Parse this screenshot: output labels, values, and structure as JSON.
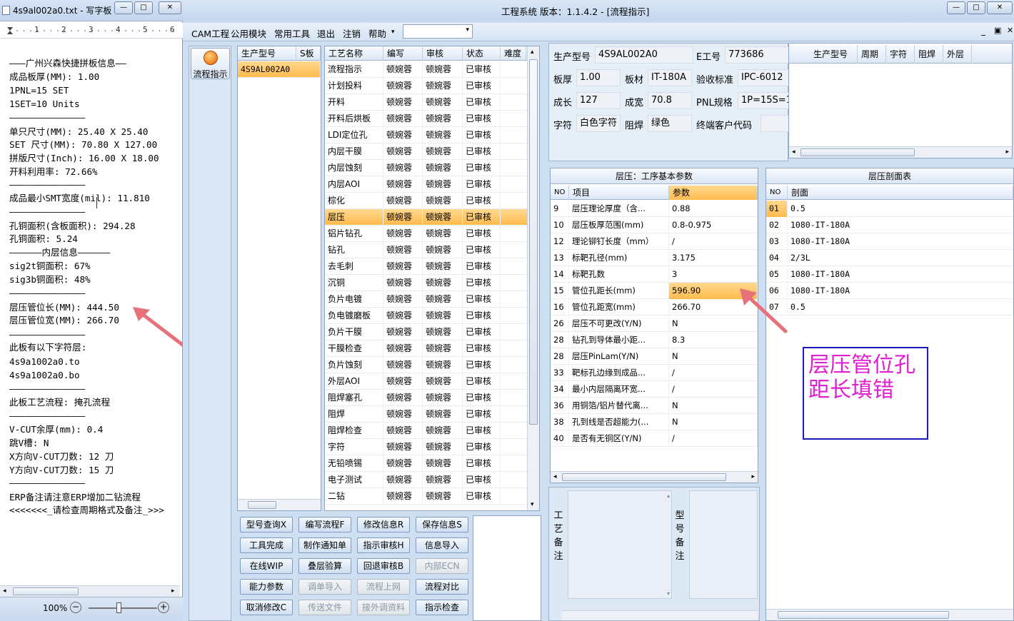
{
  "notepad": {
    "title": "4s9al002a0.txt - 写字板",
    "ruler": "·1·2·3·4·5·6",
    "ruler_marks": [
      "1",
      "2",
      "3",
      "4",
      "5",
      "6"
    ],
    "lines": [
      "———广州兴森快捷拼板信息——",
      "成品板厚(MM): 1.00",
      "1PNL=15 SET",
      "1SET=10 Units",
      "——————————————",
      "单只尺寸(MM): 25.40 X 25.40",
      "SET 尺寸(MM): 70.80 X 127.00",
      "拼版尺寸(Inch): 16.00 X 18.00",
      "开料利用率: 72.66%",
      "——————————————",
      "成品最小SMT宽度(mil): 11.810",
      "——————————————",
      "孔铜面积(含板面积): 294.28",
      "孔铜面积: 5.24",
      "——————内层信息——————",
      "sig2t铜面积: 67%",
      "sig3b铜面积: 48%",
      "——————————————",
      "层压管位长(MM): 444.50",
      "层压管位宽(MM): 266.70",
      "——————————————",
      "此板有以下字符层:",
      "4s9a1002a0.to",
      "4s9a1002a0.bo",
      "——————————————",
      "此板工艺流程: 掩孔流程",
      "——————————————",
      "V-CUT余厚(mm): 0.4",
      "跳V槽: N",
      "X方向V-CUT刀数: 12 刀",
      "Y方向V-CUT刀数: 15 刀",
      "——————————————",
      "ERP备注请注意ERP增加二钻流程",
      "<<<<<<<_请检查周期格式及备注_>>>"
    ],
    "zoom": "100%"
  },
  "app": {
    "title": "工程系统   版本：1.1.4.2 - [流程指示]",
    "menu": [
      "CAM工程",
      "公用模块",
      "常用工具",
      "退出",
      "注销",
      "帮助"
    ],
    "menu_more": "▾",
    "side_button": "流程指示",
    "model_grid": {
      "headers": [
        "生产型号",
        "S板"
      ],
      "rows": [
        [
          "4S9AL002A0",
          ""
        ]
      ]
    },
    "process_grid": {
      "headers": [
        "工艺名称",
        "编写",
        "审核",
        "状态",
        "难度"
      ],
      "rows": [
        [
          "流程指示",
          "顿婉蓉",
          "顿婉蓉",
          "已审核"
        ],
        [
          "计划投料",
          "顿婉蓉",
          "顿婉蓉",
          "已审核"
        ],
        [
          "开料",
          "顿婉蓉",
          "顿婉蓉",
          "已审核"
        ],
        [
          "开料后烘板",
          "顿婉蓉",
          "顿婉蓉",
          "已审核"
        ],
        [
          "LDI定位孔",
          "顿婉蓉",
          "顿婉蓉",
          "已审核"
        ],
        [
          "内层干膜",
          "顿婉蓉",
          "顿婉蓉",
          "已审核"
        ],
        [
          "内层蚀刻",
          "顿婉蓉",
          "顿婉蓉",
          "已审核"
        ],
        [
          "内层AOI",
          "顿婉蓉",
          "顿婉蓉",
          "已审核"
        ],
        [
          "棕化",
          "顿婉蓉",
          "顿婉蓉",
          "已审核"
        ],
        [
          "层压",
          "顿婉蓉",
          "顿婉蓉",
          "已审核"
        ],
        [
          "铝片钻孔",
          "顿婉蓉",
          "顿婉蓉",
          "已审核"
        ],
        [
          "钻孔",
          "顿婉蓉",
          "顿婉蓉",
          "已审核"
        ],
        [
          "去毛刺",
          "顿婉蓉",
          "顿婉蓉",
          "已审核"
        ],
        [
          "沉铜",
          "顿婉蓉",
          "顿婉蓉",
          "已审核"
        ],
        [
          "负片电镀",
          "顿婉蓉",
          "顿婉蓉",
          "已审核"
        ],
        [
          "负电镀磨板",
          "顿婉蓉",
          "顿婉蓉",
          "已审核"
        ],
        [
          "负片干膜",
          "顿婉蓉",
          "顿婉蓉",
          "已审核"
        ],
        [
          "干膜检查",
          "顿婉蓉",
          "顿婉蓉",
          "已审核"
        ],
        [
          "负片蚀刻",
          "顿婉蓉",
          "顿婉蓉",
          "已审核"
        ],
        [
          "外层AOI",
          "顿婉蓉",
          "顿婉蓉",
          "已审核"
        ],
        [
          "阻焊塞孔",
          "顿婉蓉",
          "顿婉蓉",
          "已审核"
        ],
        [
          "阻焊",
          "顿婉蓉",
          "顿婉蓉",
          "已审核"
        ],
        [
          "阻焊检查",
          "顿婉蓉",
          "顿婉蓉",
          "已审核"
        ],
        [
          "字符",
          "顿婉蓉",
          "顿婉蓉",
          "已审核"
        ],
        [
          "无铅喷锡",
          "顿婉蓉",
          "顿婉蓉",
          "已审核"
        ],
        [
          "电子测试",
          "顿婉蓉",
          "顿婉蓉",
          "已审核"
        ],
        [
          "二钻",
          "顿婉蓉",
          "顿婉蓉",
          "已审核"
        ]
      ]
    },
    "buttons": [
      [
        "型号查询X",
        "编写流程F",
        "修改信息R",
        "保存信息S"
      ],
      [
        "工具完成",
        "制作通知单",
        "指示审核H",
        "信息导入"
      ],
      [
        "在线WIP",
        "叠层验算",
        "回退审核B",
        "内部ECN"
      ],
      [
        "能力参数",
        "调单导入",
        "流程上网",
        "流程对比"
      ],
      [
        "取消修改C",
        "传送文件",
        "接外调资料",
        "指示检查"
      ]
    ],
    "info": {
      "model_label": "生产型号",
      "model_value": "4S9AL002A0",
      "eno_label": "E工号",
      "eno_value": "773686",
      "thick_label": "板厚",
      "thick_value": "1.00",
      "mat_label": "板材",
      "mat_value": "IT-180A",
      "std_label": "验收标准",
      "std_value": "IPC-6012",
      "len_label": "成长",
      "len_value": "127",
      "wid_label": "成宽",
      "wid_value": "70.8",
      "pnl_label": "PNL规格",
      "pnl_value": "1P=15S=1",
      "char_label": "字符",
      "char_value": "白色字符",
      "mask_label": "阻焊",
      "mask_value": "绿色",
      "cust_label": "终端客户代码",
      "cust_value": ""
    },
    "right_top_headers": [
      "生产型号",
      "周期",
      "字符",
      "阻焊",
      "外层"
    ],
    "params": {
      "title": "层压：工序基本参数",
      "headers": [
        "NO",
        "项目",
        "参数"
      ],
      "rows": [
        [
          "9",
          "层压理论厚度（含...",
          "0.88"
        ],
        [
          "10",
          "层压板厚范围(mm)",
          "0.8-0.975"
        ],
        [
          "12",
          "理论铆钉长度（mm）",
          "/"
        ],
        [
          "13",
          "标靶孔径(mm)",
          "3.175"
        ],
        [
          "14",
          "标靶孔数",
          "3"
        ],
        [
          "15",
          "管位孔距长(mm)",
          "596.90"
        ],
        [
          "16",
          "管位孔距宽(mm)",
          "266.70"
        ],
        [
          "26",
          "层压不可更改(Y/N)",
          "N"
        ],
        [
          "28",
          "钻孔到导体最小距...",
          "8.3"
        ],
        [
          "28",
          "层压PinLam(Y/N)",
          "N"
        ],
        [
          "33",
          "靶标孔边缘到成品...",
          "/"
        ],
        [
          "34",
          "最小内层隔离环宽...",
          "/"
        ],
        [
          "36",
          "用铜箔/铝片替代离...",
          "N"
        ],
        [
          "38",
          "孔到线是否超能力(...",
          "N"
        ],
        [
          "40",
          "是否有无铜区(Y/N)",
          "/"
        ]
      ]
    },
    "stackup": {
      "title": "层压剖面表",
      "headers": [
        "NO",
        "剖面"
      ],
      "rows": [
        [
          "01",
          "0.5"
        ],
        [
          "02",
          "1080-IT-180A"
        ],
        [
          "03",
          "1080-IT-180A"
        ],
        [
          "04",
          "2/3L"
        ],
        [
          "05",
          "1080-IT-180A"
        ],
        [
          "06",
          "1080-IT-180A"
        ],
        [
          "07",
          "0.5"
        ]
      ]
    },
    "remarks": {
      "process_label": "工艺备注",
      "model_label": "型号备注"
    },
    "annotation": "层压管位孔距长填错"
  },
  "colors": {
    "highlight": "#ffbb4d",
    "annotation_text": "#e020d0",
    "annotation_border": "#1a1ab8",
    "arrow": "#e8707a"
  }
}
